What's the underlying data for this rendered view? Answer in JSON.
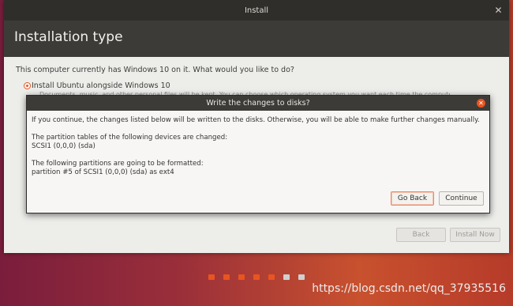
{
  "window": {
    "title": "Install"
  },
  "header": {
    "title": "Installation type"
  },
  "main": {
    "question": "This computer currently has Windows 10 on it. What would you like to do?",
    "option_label": "Install Ubuntu alongside Windows 10",
    "option_desc": "Documents, music, and other personal files will be kept. You can choose which operating system you want each time the computer starts up."
  },
  "footer": {
    "back_label": "Back",
    "install_label": "Install Now"
  },
  "dialog": {
    "title": "Write the changes to disks?",
    "message": "If you continue, the changes listed below will be written to the disks. Otherwise, you will be able to make further changes manually.",
    "partition_tables_heading": "The partition tables of the following devices are changed:",
    "partition_tables_item": "SCSI1 (0,0,0) (sda)",
    "formatted_heading": "The following partitions are going to be formatted:",
    "formatted_item": "partition #5 of SCSI1 (0,0,0) (sda) as ext4",
    "goback_label": "Go Back",
    "continue_label": "Continue"
  },
  "progress": {
    "colors": [
      "#e95420",
      "#e95420",
      "#e95420",
      "#e95420",
      "#e95420",
      "#cfcfcf",
      "#cfcfcf"
    ],
    "completed_steps": 5,
    "total_steps": 7
  },
  "watermark": "https://blog.csdn.net/qq_37935516"
}
